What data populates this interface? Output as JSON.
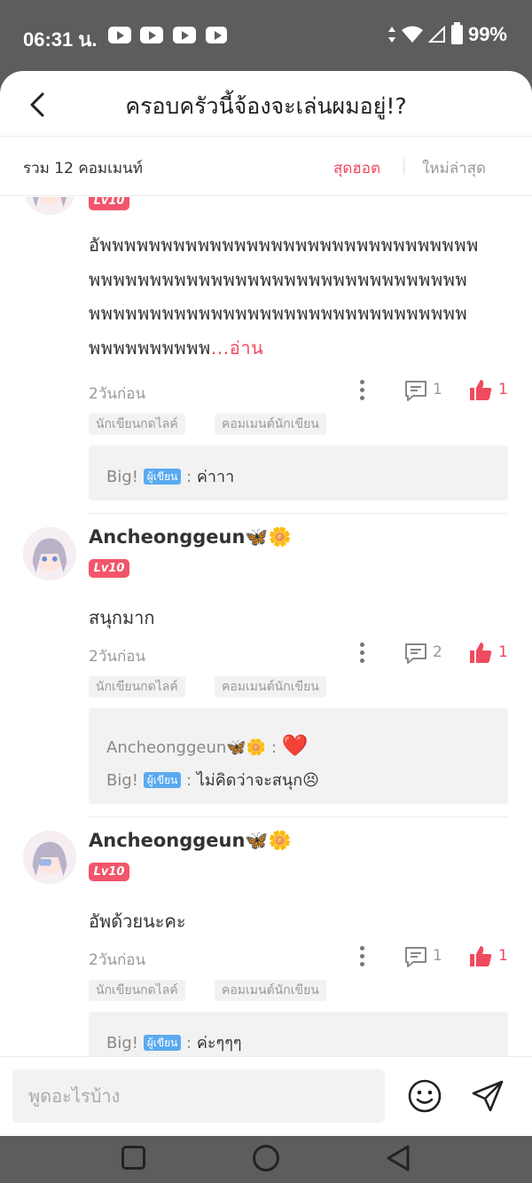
{
  "status_bar": {
    "time": "06:31 น.",
    "battery": "99%"
  },
  "header": {
    "title": "ครอบครัวนี้จ้องจะเล่นผมอยู่!?"
  },
  "subheader": {
    "count": "รวม 12 คอมเมนท์",
    "sort_hot": "สุดฮอต",
    "sort_new": "ใหม่ล่าสุด"
  },
  "comments": [
    {
      "level": "Lv10",
      "body": "อัพพพพพพพพพพพพพพพพพพพพพพพพพพพพพพพพพพพพพพพพพพพพพพพพพพพพพพพพพพพพพพพพพพพพพพพพพพพพพพพพพพพพพพพพพพพพพพพพพพพพพพพ",
      "more": "...อ่าน",
      "time": "2วันก่อน",
      "reply_count": "1",
      "like_count": "1",
      "tags": [
        "นักเขียนกดไลค์",
        "คอมเมนต์นักเขียน"
      ],
      "replies": [
        {
          "user": "Big!",
          "badge": "ผู้เขียน",
          "text": "ค่าาา"
        }
      ]
    },
    {
      "user": "Ancheonggeun🦋🌼",
      "level": "Lv10",
      "body": "สนุกมาก",
      "time": "2วันก่อน",
      "reply_count": "2",
      "like_count": "1",
      "tags": [
        "นักเขียนกดไลค์",
        "คอมเมนต์นักเขียน"
      ],
      "replies": [
        {
          "user": "Ancheonggeun🦋🌼",
          "text": "❤️"
        },
        {
          "user": "Big!",
          "badge": "ผู้เขียน",
          "text": "ไม่คิดว่าจะสนุก😣"
        }
      ]
    },
    {
      "user": "Ancheonggeun🦋🌼",
      "level": "Lv10",
      "body": "อัพด้วยนะคะ",
      "time": "2วันก่อน",
      "reply_count": "1",
      "like_count": "1",
      "tags": [
        "นักเขียนกดไลค์",
        "คอมเมนต์นักเขียน"
      ],
      "replies": [
        {
          "user": "Big!",
          "badge": "ผู้เขียน",
          "text": "ค่ะๆๆๆ"
        }
      ]
    }
  ],
  "input": {
    "placeholder": "พูดอะไรบ้าง"
  },
  "colors": {
    "accent": "#f04a5e",
    "author_badge": "#5aaaf0",
    "level_badge": "#f2556b"
  }
}
